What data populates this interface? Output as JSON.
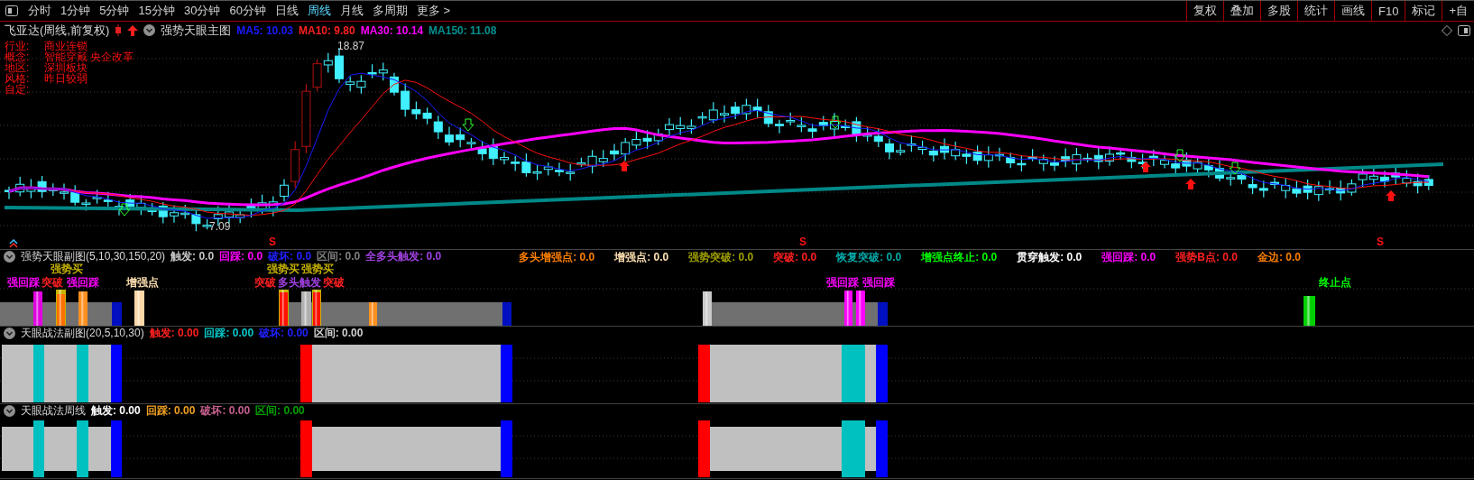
{
  "toolbar": {
    "periods": [
      {
        "label": "分时",
        "selected": false
      },
      {
        "label": "1分钟",
        "selected": false
      },
      {
        "label": "5分钟",
        "selected": false
      },
      {
        "label": "15分钟",
        "selected": false
      },
      {
        "label": "30分钟",
        "selected": false
      },
      {
        "label": "60分钟",
        "selected": false
      },
      {
        "label": "日线",
        "selected": false
      },
      {
        "label": "周线",
        "selected": true
      },
      {
        "label": "月线",
        "selected": false
      },
      {
        "label": "多周期",
        "selected": false
      },
      {
        "label": "更多 >",
        "selected": false
      }
    ],
    "tools": [
      "复权",
      "叠加",
      "多股",
      "统计",
      "画线",
      "F10",
      "标记",
      "+自"
    ]
  },
  "main_chart": {
    "title": "飞亚达(周线,前复权)",
    "indicator": "强势天眼主图",
    "legend": [
      {
        "text": "MA5: 10.03",
        "color": "#1a1aff"
      },
      {
        "text": "MA10: 9.80",
        "color": "#ff2020"
      },
      {
        "text": "MA30: 10.14",
        "color": "#ff00ff"
      },
      {
        "text": "MA150: 11.08",
        "color": "#009090"
      }
    ],
    "info": [
      {
        "label": "行业:",
        "value": "商业连锁"
      },
      {
        "label": "概念:",
        "value": "智能穿戴 央企改革"
      },
      {
        "label": "地区:",
        "value": "深圳板块"
      },
      {
        "label": "风格:",
        "value": "昨日较弱"
      },
      {
        "label": "自定:"
      }
    ],
    "high_label": "18.87",
    "low_label": "7.09",
    "signals": [
      "S",
      "S",
      "S"
    ]
  },
  "panels": [
    {
      "title": "强势天眼副图(5,10,30,150,20)",
      "legend": [
        {
          "text": "触发: 0.0",
          "color": "#c8c8c8"
        },
        {
          "text": "回踩: 0.0",
          "color": "#ff00ff"
        },
        {
          "text": "破坏: 0.0",
          "color": "#2020ff"
        },
        {
          "text": "区间: 0.0",
          "color": "#808080"
        },
        {
          "text": "全多头触发: 0.0",
          "color": "#a040e0"
        }
      ],
      "legend_2": [
        {
          "text": "多头增强点: 0.0",
          "color": "#ff8000"
        },
        {
          "text": "增强点: 0.0",
          "color": "#ffe0b0"
        },
        {
          "text": "强势突破: 0.0",
          "color": "#a0a000"
        },
        {
          "text": "突破: 0.0",
          "color": "#ff2020"
        },
        {
          "text": "恢复突破: 0.0",
          "color": "#00a8a8"
        },
        {
          "text": "增强点终止: 0.0",
          "color": "#00ff00"
        },
        {
          "text": "贯穿触发: 0.0",
          "color": "#ffffff"
        },
        {
          "text": "强回踩: 0.0",
          "color": "#ff00ff"
        },
        {
          "text": "强势B点: 0.0",
          "color": "#ff2020"
        },
        {
          "text": "金边: 0.0",
          "color": "#ff8000"
        }
      ],
      "marks": [
        {
          "text": "强势买",
          "color": "#c8b400"
        },
        {
          "text": "强回踩",
          "color": "#ff00ff"
        },
        {
          "text": "突破",
          "color": "#ff2020"
        },
        {
          "text": "强回踩",
          "color": "#ff00ff"
        },
        {
          "text": "增强点",
          "color": "#ffe0b0"
        },
        {
          "text": "强势买",
          "color": "#c8b400"
        },
        {
          "text": "强势买",
          "color": "#c8b400"
        },
        {
          "text": "突破",
          "color": "#ff2020"
        },
        {
          "text": "多头触发",
          "color": "#a040e0"
        },
        {
          "text": "突破",
          "color": "#ff2020"
        },
        {
          "text": "强回踩",
          "color": "#ff00ff"
        },
        {
          "text": "强回踩",
          "color": "#ff00ff"
        },
        {
          "text": "终止点",
          "color": "#00ff00"
        }
      ]
    },
    {
      "title": "天眼战法副图(20,5,10,30)",
      "legend": [
        {
          "text": "触发: 0.00",
          "color": "#ff2020"
        },
        {
          "text": "回踩: 0.00",
          "color": "#00c8c8"
        },
        {
          "text": "破坏: 0.00",
          "color": "#2020ff"
        },
        {
          "text": "区间: 0.00",
          "color": "#d0d0d0"
        }
      ]
    },
    {
      "title": "天眼战法周线",
      "legend": [
        {
          "text": "触发: 0.00",
          "color": "#ffffff"
        },
        {
          "text": "回踩: 0.00",
          "color": "#f0a020"
        },
        {
          "text": "破坏: 0.00",
          "color": "#c86090"
        },
        {
          "text": "区间: 0.00",
          "color": "#00a000"
        }
      ]
    }
  ]
}
